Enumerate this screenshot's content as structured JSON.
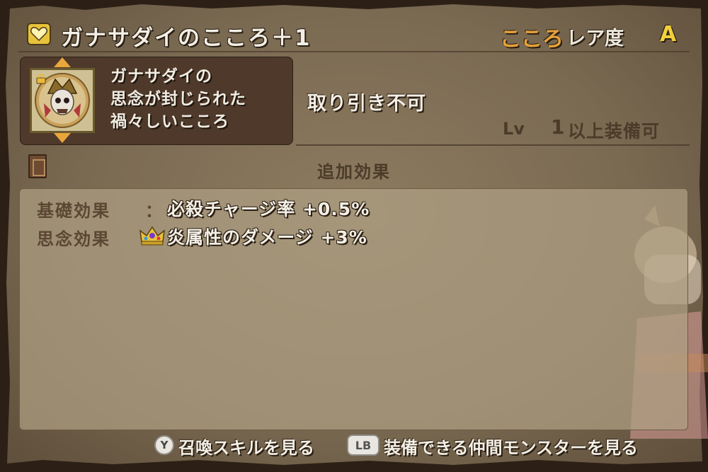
{
  "header": {
    "title": "ガナサダイのこころ＋1",
    "category": "こころ",
    "rarity_label": "レア度",
    "rarity_grade": "A"
  },
  "item": {
    "description": [
      "ガナサダイの",
      "思念が封じられた",
      "禍々しいこころ"
    ],
    "trade_status": "取り引き不可",
    "level_label": "Lv",
    "level_value": "1",
    "level_suffix": "以上装備可"
  },
  "effects": {
    "section_title": "追加効果",
    "rows": [
      {
        "label": "基礎効果",
        "separator": "：",
        "value": "必殺チャージ率 +0.5%"
      },
      {
        "label": "思念効果",
        "separator": "",
        "value": "炎属性のダメージ +3%",
        "icon": "crown-icon"
      }
    ]
  },
  "footer": {
    "y_button": "Y",
    "y_action": "召喚スキルを見る",
    "lb_button": "LB",
    "lb_action": "装備できる仲間モンスターを見る"
  },
  "colors": {
    "title_text": "#f3efe6",
    "kokoro_orange": "#e6a23c",
    "grade_yellow": "#f2d23a",
    "parchment": "#8d7b60",
    "item_box": "#4e392a"
  }
}
